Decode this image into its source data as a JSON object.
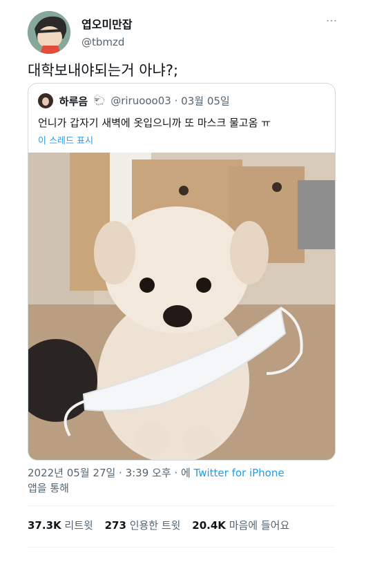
{
  "author": {
    "name": "엽오미만잡",
    "handle": "@tbmzd"
  },
  "tweet_text": "대학보내야되는거 아냐?;",
  "quoted": {
    "name": "하루음",
    "handle": "@riruooo03",
    "separator": "·",
    "date": "03월 05일",
    "text": "언니가 갑자기 새벽에 옷입으니까 또 마스크 물고옴 ㅠ",
    "thread_link": "이 스레드 표시"
  },
  "timestamp": "2022년 05월 27일 · 3:39 오후 · 에",
  "source_app": "Twitter for iPhone",
  "source_suffix": "앱을 통해",
  "stats": {
    "retweets_count": "37.3K",
    "retweets_label": "리트윗",
    "quotes_count": "273",
    "quotes_label": "인용한 트윗",
    "likes_count": "20.4K",
    "likes_label": "마음에 들어요"
  },
  "icons": {
    "more": "more-vertical-icon",
    "emoji": "sheep-cloud-emoji"
  },
  "colors": {
    "link": "#1d9bf0",
    "secondary": "#536471",
    "border": "#cfd9de"
  }
}
